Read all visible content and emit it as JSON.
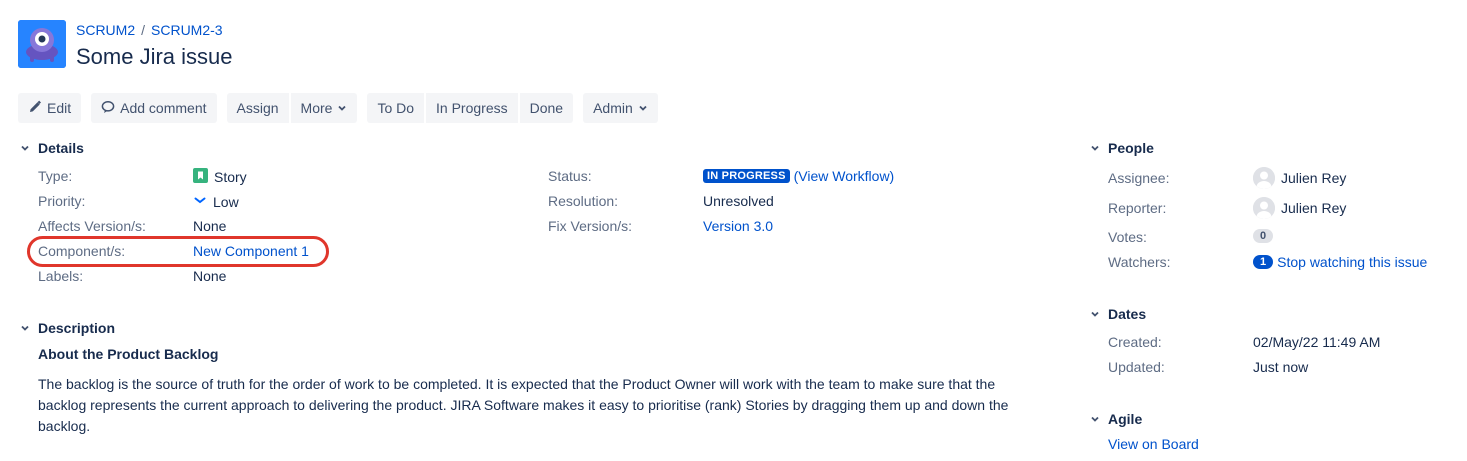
{
  "header": {
    "project_key": "SCRUM2",
    "separator": "/",
    "issue_key": "SCRUM2-3",
    "title": "Some Jira issue"
  },
  "toolbar": {
    "edit": "Edit",
    "add_comment": "Add comment",
    "assign": "Assign",
    "more": "More",
    "todo": "To Do",
    "in_progress": "In Progress",
    "done": "Done",
    "admin": "Admin"
  },
  "details": {
    "heading": "Details",
    "type_label": "Type:",
    "type_value": "Story",
    "priority_label": "Priority:",
    "priority_value": "Low",
    "affects_label": "Affects Version/s:",
    "affects_value": "None",
    "component_label": "Component/s:",
    "component_value": "New Component 1",
    "labels_label": "Labels:",
    "labels_value": "None",
    "status_label": "Status:",
    "status_value": "IN PROGRESS",
    "view_workflow": "(View Workflow)",
    "resolution_label": "Resolution:",
    "resolution_value": "Unresolved",
    "fix_label": "Fix Version/s:",
    "fix_value": "Version 3.0"
  },
  "description": {
    "heading": "Description",
    "subheading": "About the Product Backlog",
    "body": "The backlog is the source of truth for the order of work to be completed. It is expected that the Product Owner will work with the team to make sure that the backlog represents the current approach to delivering the product. JIRA Software makes it easy to prioritise (rank) Stories by dragging them up and down the backlog."
  },
  "people": {
    "heading": "People",
    "assignee_label": "Assignee:",
    "assignee_value": "Julien Rey",
    "reporter_label": "Reporter:",
    "reporter_value": "Julien Rey",
    "votes_label": "Votes:",
    "votes_value": "0",
    "watchers_label": "Watchers:",
    "watchers_count": "1",
    "watchers_link": "Stop watching this issue"
  },
  "dates": {
    "heading": "Dates",
    "created_label": "Created:",
    "created_value": "02/May/22 11:49 AM",
    "updated_label": "Updated:",
    "updated_value": "Just now"
  },
  "agile": {
    "heading": "Agile",
    "view_on_board": "View on Board"
  },
  "colors": {
    "link": "#0052cc",
    "status_lozenge": "#0052cc",
    "story_icon": "#36b37e",
    "highlight": "#e0362b"
  },
  "icons": {
    "project": "project-avatar-icon",
    "edit": "pencil-icon",
    "comment": "comment-icon",
    "dropdown": "chevron-down-icon",
    "story": "story-icon",
    "priority_low": "priority-low-icon",
    "user": "user-avatar-icon"
  }
}
